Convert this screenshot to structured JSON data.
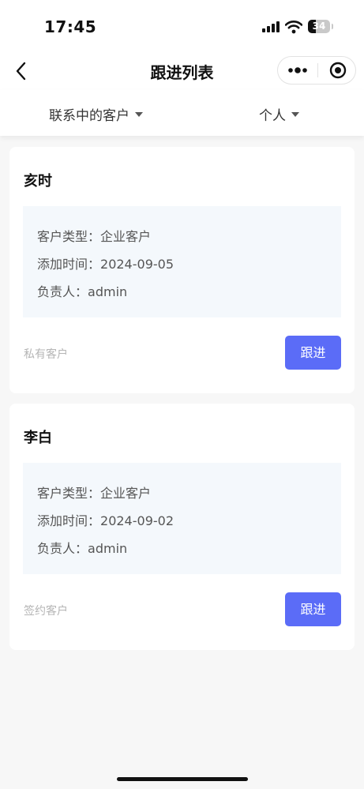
{
  "status_bar": {
    "time": "17:45",
    "battery": "34",
    "battery_level": 0.34
  },
  "nav": {
    "title": "跟进列表",
    "icons": [
      "back-arrow-icon",
      "more-dots-icon",
      "record-target-icon"
    ]
  },
  "filters": [
    {
      "label": "联系中的客户"
    },
    {
      "label": "个人"
    }
  ],
  "customers": [
    {
      "name": "亥时",
      "type_label": "客户类型：",
      "type": "企业客户",
      "added_label": "添加时间：",
      "added": "2024-09-05",
      "owner_label": "负责人：",
      "owner": "admin",
      "tag": "私有客户",
      "action": "跟进"
    },
    {
      "name": "李白",
      "type_label": "客户类型：",
      "type": "企业客户",
      "added_label": "添加时间：",
      "added": "2024-09-02",
      "owner_label": "负责人：",
      "owner": "admin",
      "tag": "签约客户",
      "action": "跟进"
    }
  ],
  "colors": {
    "accent": "#5b6cf7",
    "info_bg": "#f4f8fc",
    "page_bg": "#f7f7f7"
  }
}
